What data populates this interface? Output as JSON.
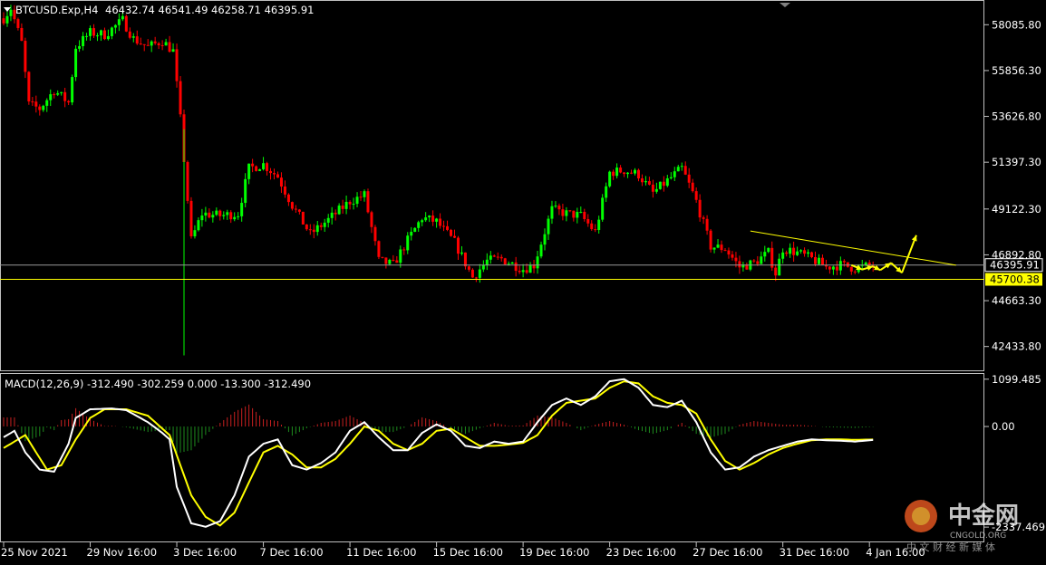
{
  "header": {
    "symbol": "BTCUSD.Exp,H4",
    "ohlc": "46432.74 46541.49 46258.71 46395.91"
  },
  "indicator": {
    "label": "MACD(12,26,9) -312.490 -302.259 0.000 -13.300 -312.490"
  },
  "colors": {
    "background": "#000000",
    "bull": "#00ff00",
    "bear": "#ff0000",
    "macd_line": "#ffffff",
    "signal_line": "#ffff00",
    "hist_pos": "#c82020",
    "hist_neg": "#1e8c1e",
    "drawing": "#ffff00",
    "axis_text": "#ffffff"
  },
  "price_tags": {
    "current": "46395.91",
    "support": "45700.38"
  },
  "watermark": {
    "brand": "中金网",
    "url": "CNGOLD.ORG",
    "tagline": "中 文 财 经 新 媒 体"
  },
  "chart_data": {
    "type": "candlestick",
    "candle_count": 330,
    "price_axis": {
      "range": [
        41319,
        59200
      ],
      "ticks": [
        "58085.80",
        "55856.30",
        "53626.80",
        "51397.30",
        "49122.30",
        "46892.80",
        "44663.30",
        "42433.80"
      ]
    },
    "macd_axis": {
      "range": [
        -2650,
        1200
      ],
      "ticks": [
        "1099.485",
        "0.00",
        "-2337.469"
      ]
    },
    "time_axis": {
      "labels": [
        "25 Nov 2021",
        "29 Nov 16:00",
        "3 Dec 16:00",
        "7 Dec 16:00",
        "11 Dec 16:00",
        "15 Dec 16:00",
        "19 Dec 16:00",
        "23 Dec 16:00",
        "27 Dec 16:00",
        "31 Dec 16:00",
        "4 Jan 16:00"
      ],
      "label_candle_index": [
        0,
        24,
        48,
        72,
        96,
        120,
        144,
        168,
        192,
        216,
        240
      ]
    },
    "close_anchors": [
      [
        0,
        58400
      ],
      [
        2,
        58900
      ],
      [
        5,
        57200
      ],
      [
        7,
        54200
      ],
      [
        10,
        54000
      ],
      [
        14,
        54900
      ],
      [
        18,
        54300
      ],
      [
        20,
        57000
      ],
      [
        24,
        57700
      ],
      [
        28,
        57600
      ],
      [
        33,
        58300
      ],
      [
        36,
        57400
      ],
      [
        40,
        57000
      ],
      [
        44,
        57300
      ],
      [
        47,
        56800
      ],
      [
        49,
        53500
      ],
      [
        52,
        47600
      ],
      [
        55,
        48900
      ],
      [
        60,
        48800
      ],
      [
        65,
        48900
      ],
      [
        68,
        51100
      ],
      [
        72,
        51300
      ],
      [
        76,
        50700
      ],
      [
        80,
        49300
      ],
      [
        85,
        47900
      ],
      [
        90,
        48600
      ],
      [
        96,
        49500
      ],
      [
        100,
        49800
      ],
      [
        104,
        46600
      ],
      [
        108,
        46400
      ],
      [
        112,
        47600
      ],
      [
        116,
        48700
      ],
      [
        120,
        48500
      ],
      [
        125,
        47500
      ],
      [
        130,
        45800
      ],
      [
        134,
        46600
      ],
      [
        138,
        46700
      ],
      [
        144,
        46200
      ],
      [
        147,
        46400
      ],
      [
        152,
        49100
      ],
      [
        156,
        48900
      ],
      [
        160,
        48800
      ],
      [
        164,
        48000
      ],
      [
        168,
        50900
      ],
      [
        172,
        51000
      ],
      [
        176,
        50800
      ],
      [
        180,
        49900
      ],
      [
        184,
        50500
      ],
      [
        188,
        51100
      ],
      [
        192,
        49500
      ],
      [
        196,
        47300
      ],
      [
        200,
        47200
      ],
      [
        204,
        46300
      ],
      [
        208,
        46500
      ],
      [
        212,
        47000
      ],
      [
        214,
        46000
      ],
      [
        216,
        47200
      ],
      [
        220,
        47000
      ],
      [
        224,
        46700
      ],
      [
        228,
        46300
      ],
      [
        232,
        46400
      ],
      [
        236,
        46250
      ],
      [
        238,
        46300
      ],
      [
        241,
        46400
      ]
    ],
    "current_price": 46395.91,
    "support_level": 45700.38,
    "trendline": [
      [
        207,
        48050
      ],
      [
        264,
        46390
      ]
    ],
    "projection_path": [
      [
        235,
        46390
      ],
      [
        238,
        46180
      ],
      [
        241,
        46330
      ],
      [
        243,
        46150
      ],
      [
        246,
        46500
      ],
      [
        249,
        46020
      ],
      [
        253,
        47850
      ]
    ],
    "macd": [
      [
        0,
        -250
      ],
      [
        3,
        -100
      ],
      [
        6,
        -600
      ],
      [
        10,
        -1000
      ],
      [
        14,
        -1050
      ],
      [
        18,
        -400
      ],
      [
        20,
        200
      ],
      [
        24,
        400
      ],
      [
        30,
        420
      ],
      [
        34,
        380
      ],
      [
        40,
        100
      ],
      [
        44,
        -150
      ],
      [
        46,
        -300
      ],
      [
        48,
        -1400
      ],
      [
        52,
        -2250
      ],
      [
        56,
        -2330
      ],
      [
        60,
        -2200
      ],
      [
        64,
        -1600
      ],
      [
        68,
        -700
      ],
      [
        72,
        -400
      ],
      [
        76,
        -300
      ],
      [
        80,
        -900
      ],
      [
        84,
        -1000
      ],
      [
        88,
        -850
      ],
      [
        92,
        -600
      ],
      [
        96,
        -100
      ],
      [
        100,
        100
      ],
      [
        104,
        -250
      ],
      [
        108,
        -550
      ],
      [
        112,
        -550
      ],
      [
        116,
        -150
      ],
      [
        120,
        50
      ],
      [
        124,
        -100
      ],
      [
        128,
        -450
      ],
      [
        132,
        -500
      ],
      [
        136,
        -350
      ],
      [
        140,
        -400
      ],
      [
        144,
        -350
      ],
      [
        148,
        100
      ],
      [
        152,
        500
      ],
      [
        156,
        650
      ],
      [
        160,
        500
      ],
      [
        164,
        700
      ],
      [
        168,
        1050
      ],
      [
        172,
        1100
      ],
      [
        176,
        900
      ],
      [
        180,
        500
      ],
      [
        184,
        450
      ],
      [
        188,
        600
      ],
      [
        192,
        100
      ],
      [
        196,
        -600
      ],
      [
        200,
        -1000
      ],
      [
        204,
        -950
      ],
      [
        208,
        -700
      ],
      [
        212,
        -550
      ],
      [
        216,
        -450
      ],
      [
        220,
        -350
      ],
      [
        224,
        -300
      ],
      [
        228,
        -320
      ],
      [
        232,
        -330
      ],
      [
        236,
        -350
      ],
      [
        241,
        -312
      ]
    ],
    "signal": [
      [
        0,
        -500
      ],
      [
        6,
        -200
      ],
      [
        12,
        -1000
      ],
      [
        16,
        -900
      ],
      [
        20,
        -300
      ],
      [
        24,
        200
      ],
      [
        28,
        400
      ],
      [
        34,
        400
      ],
      [
        40,
        250
      ],
      [
        46,
        -200
      ],
      [
        52,
        -1600
      ],
      [
        56,
        -2100
      ],
      [
        60,
        -2300
      ],
      [
        64,
        -2000
      ],
      [
        68,
        -1300
      ],
      [
        72,
        -600
      ],
      [
        76,
        -450
      ],
      [
        80,
        -650
      ],
      [
        84,
        -950
      ],
      [
        88,
        -950
      ],
      [
        92,
        -750
      ],
      [
        96,
        -400
      ],
      [
        100,
        0
      ],
      [
        104,
        -100
      ],
      [
        108,
        -400
      ],
      [
        112,
        -550
      ],
      [
        116,
        -400
      ],
      [
        120,
        -100
      ],
      [
        124,
        -50
      ],
      [
        128,
        -250
      ],
      [
        132,
        -450
      ],
      [
        136,
        -450
      ],
      [
        140,
        -420
      ],
      [
        144,
        -380
      ],
      [
        148,
        -200
      ],
      [
        152,
        250
      ],
      [
        156,
        550
      ],
      [
        160,
        600
      ],
      [
        164,
        650
      ],
      [
        168,
        900
      ],
      [
        172,
        1050
      ],
      [
        176,
        1000
      ],
      [
        180,
        700
      ],
      [
        184,
        550
      ],
      [
        188,
        500
      ],
      [
        192,
        300
      ],
      [
        196,
        -300
      ],
      [
        200,
        -800
      ],
      [
        204,
        -1000
      ],
      [
        208,
        -850
      ],
      [
        212,
        -650
      ],
      [
        216,
        -500
      ],
      [
        220,
        -400
      ],
      [
        224,
        -320
      ],
      [
        228,
        -300
      ],
      [
        232,
        -300
      ],
      [
        236,
        -310
      ],
      [
        241,
        -302
      ]
    ]
  }
}
